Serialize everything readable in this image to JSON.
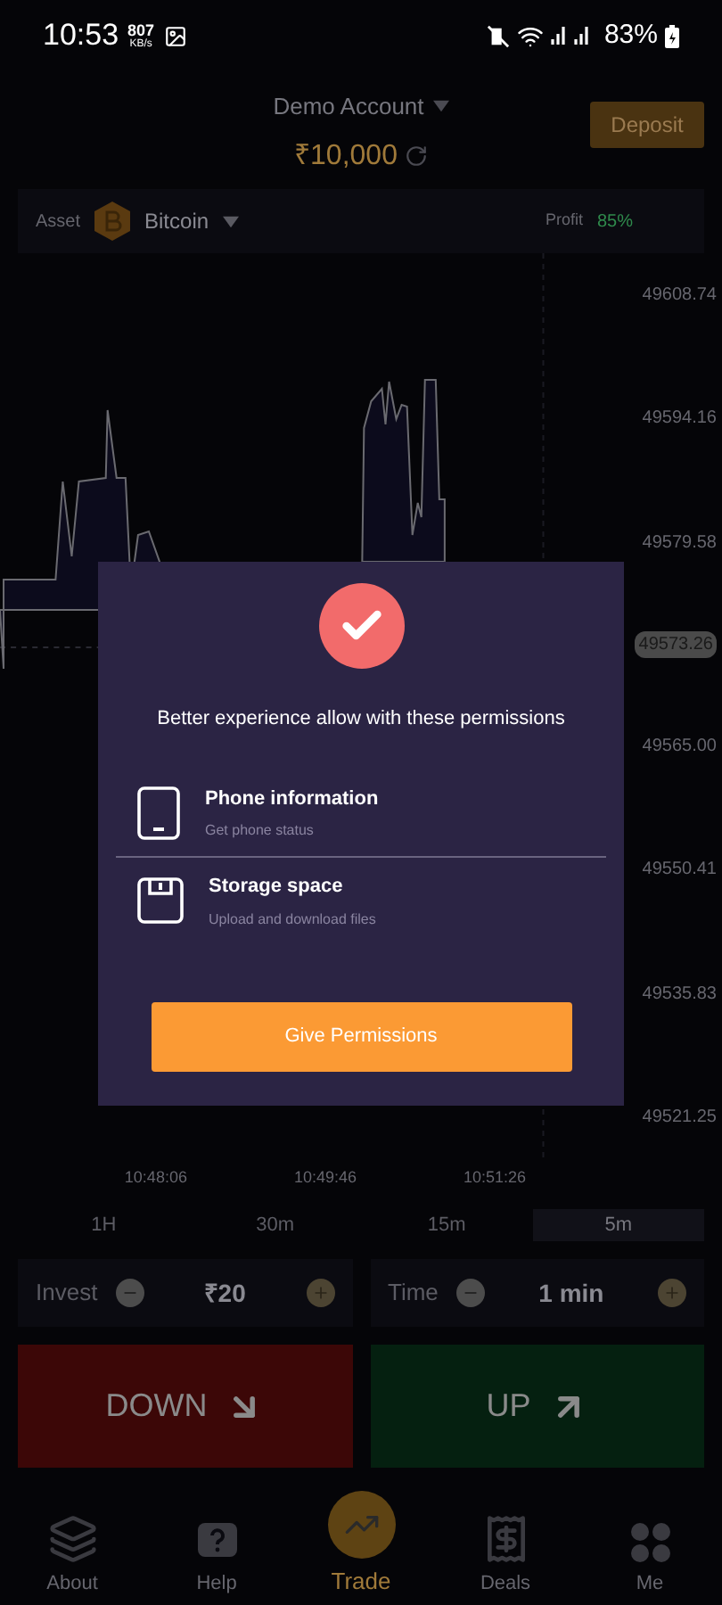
{
  "status_bar": {
    "time": "10:53",
    "speed_value": "807",
    "speed_unit": "KB/s",
    "battery": "83%"
  },
  "header": {
    "account": "Demo Account",
    "balance": "₹10,000",
    "deposit_button": "Deposit"
  },
  "asset_bar": {
    "label": "Asset",
    "asset": "Bitcoin",
    "profit_label": "Profit",
    "profit": "85%"
  },
  "chart": {
    "price_labels": [
      "49608.74",
      "49594.16",
      "49579.58",
      "49565.00",
      "49550.41",
      "49535.83",
      "49521.25"
    ],
    "current_price": "49573.26",
    "time_labels": [
      "10:48:06",
      "10:49:46",
      "10:51:26"
    ]
  },
  "timeframes": [
    {
      "label": "1H",
      "selected": false
    },
    {
      "label": "30m",
      "selected": false
    },
    {
      "label": "15m",
      "selected": false
    },
    {
      "label": "5m",
      "selected": true
    }
  ],
  "invest": {
    "label": "Invest",
    "value": "₹20"
  },
  "time": {
    "label": "Time",
    "value": "1 min"
  },
  "trade_buttons": [
    {
      "kind": "down",
      "label": "DOWN"
    },
    {
      "kind": "up",
      "label": "UP"
    }
  ],
  "bottom_nav": [
    {
      "kind": "about",
      "label": "About",
      "selected": false
    },
    {
      "kind": "help",
      "label": "Help",
      "selected": false
    },
    {
      "kind": "trade",
      "label": "Trade",
      "selected": true
    },
    {
      "kind": "deals",
      "label": "Deals",
      "selected": false
    },
    {
      "kind": "me",
      "label": "Me",
      "selected": false
    }
  ],
  "dialog": {
    "title": "Better experience allow with these permissions",
    "permissions": [
      {
        "kind": "phone",
        "title": "Phone information",
        "subtitle": "Get phone status"
      },
      {
        "kind": "storage",
        "title": "Storage space",
        "subtitle": "Upload and download files"
      }
    ],
    "button": "Give Permissions"
  }
}
